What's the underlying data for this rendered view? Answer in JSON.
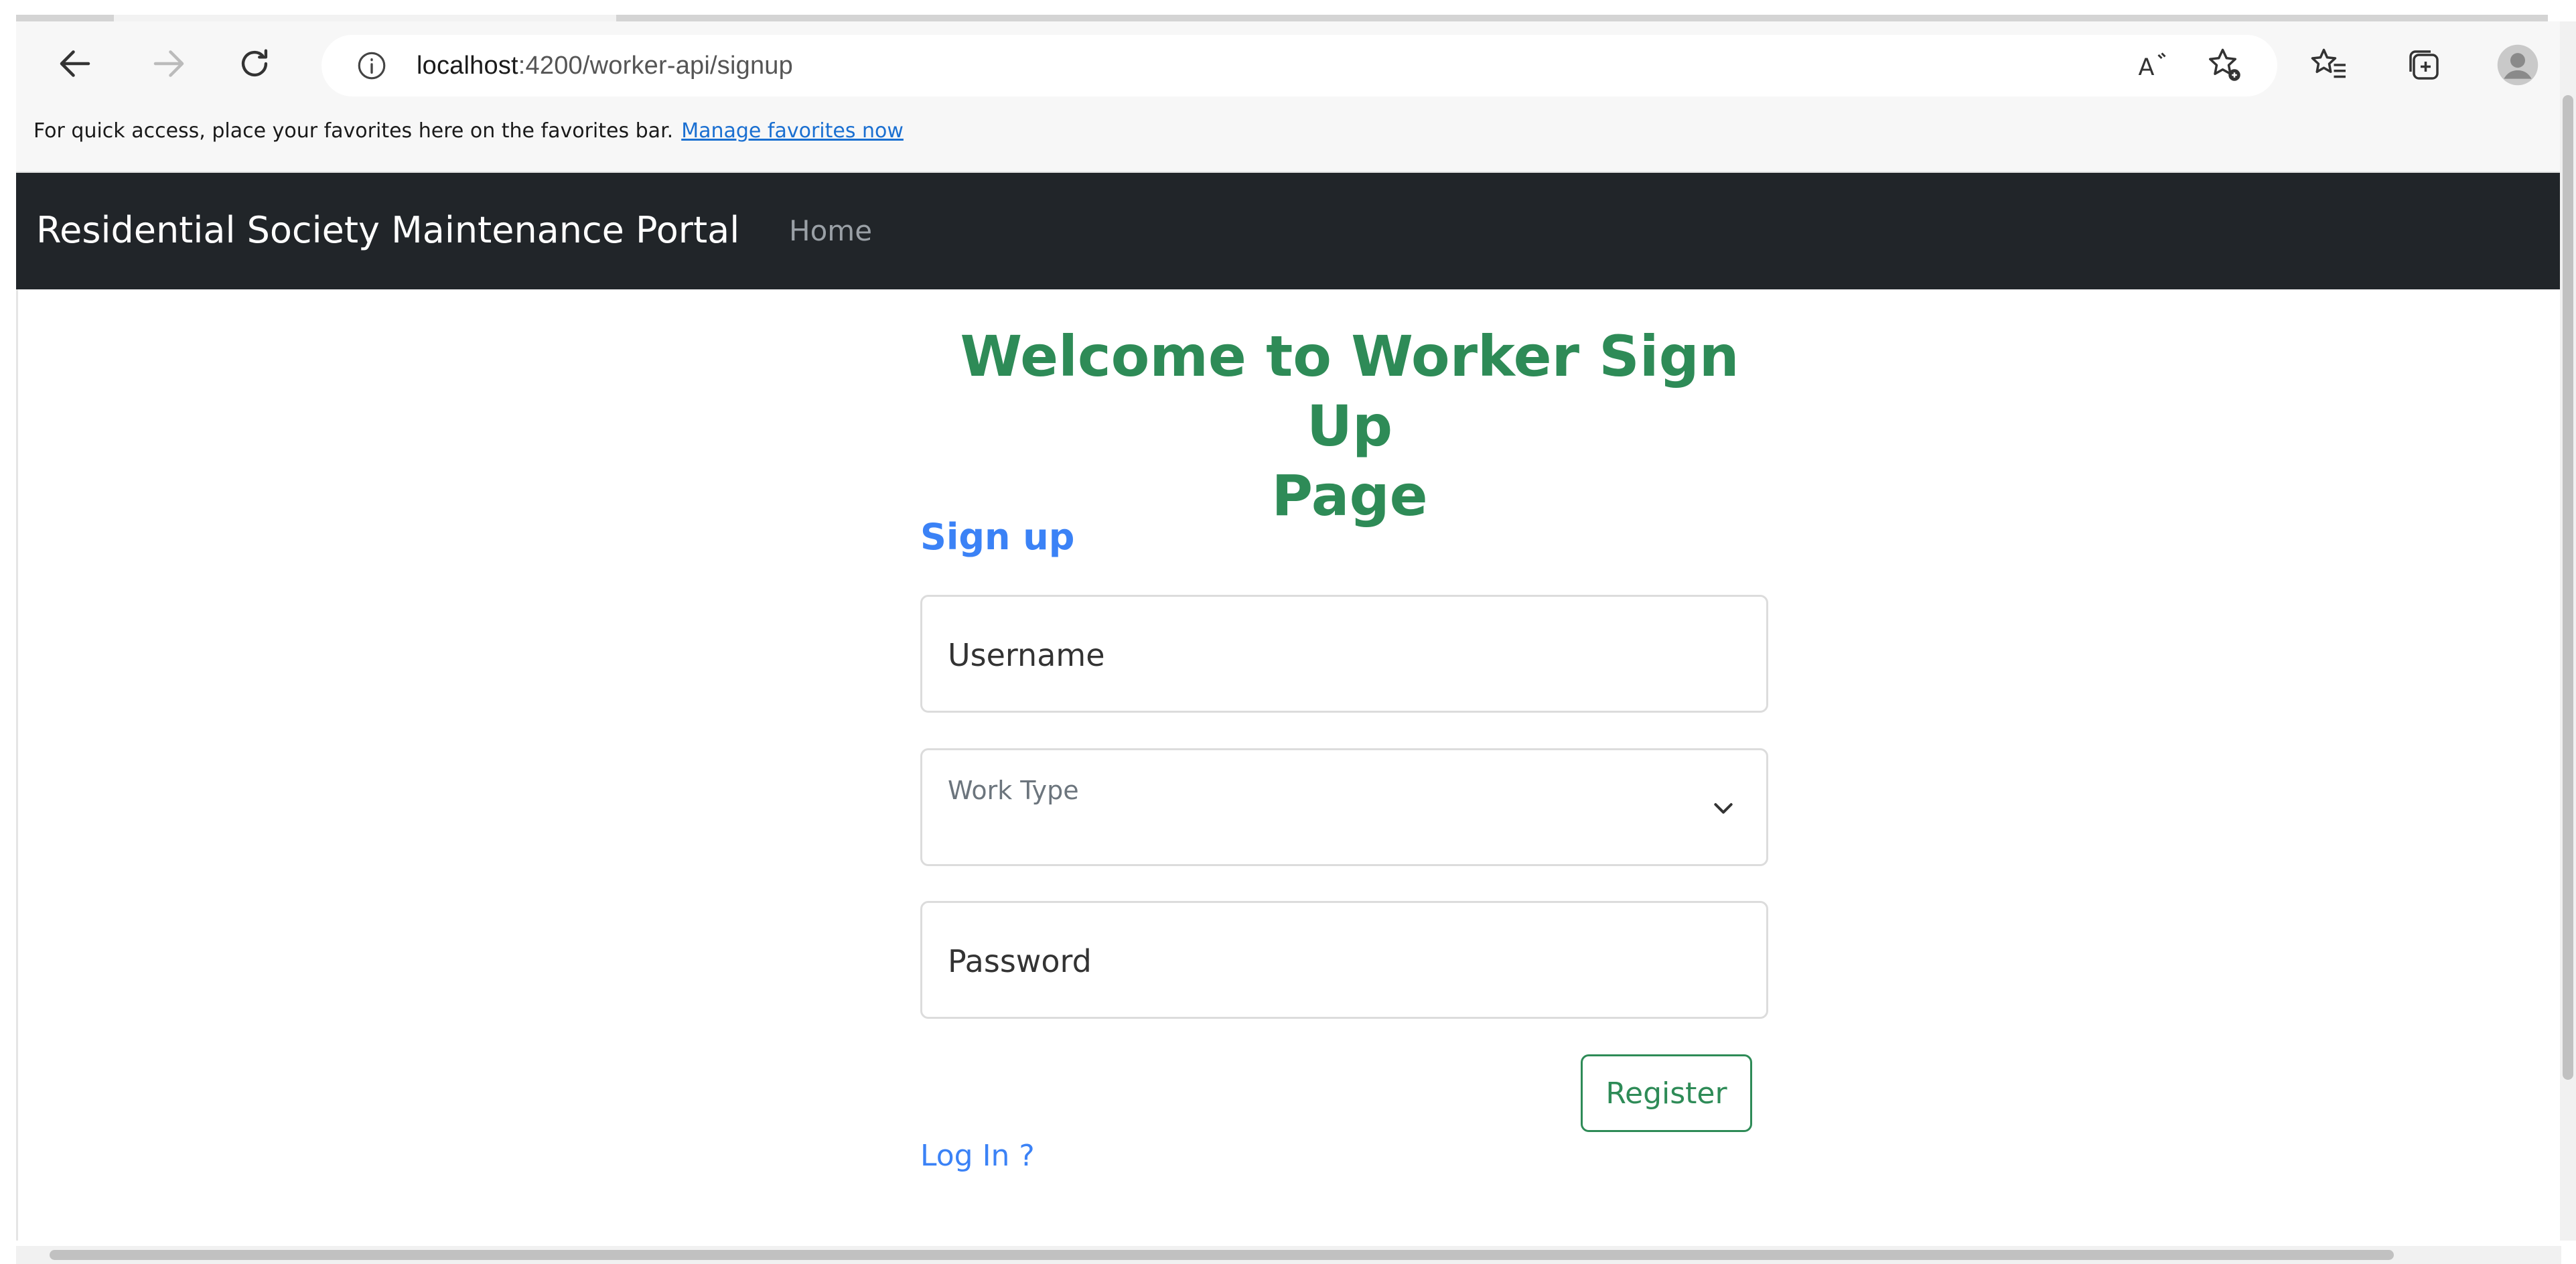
{
  "browser": {
    "url_host": "localhost",
    "url_path": ":4200/worker-api/signup",
    "favorites_prompt": "For quick access, place your favorites here on the favorites bar.",
    "favorites_link": "Manage favorites now",
    "icons": {
      "back": "back-arrow-icon",
      "forward": "forward-arrow-icon",
      "refresh": "refresh-icon",
      "info": "info-icon",
      "read_aloud": "read-aloud-icon",
      "add_favorite": "add-favorite-icon",
      "favorites": "favorites-icon",
      "collections": "collections-icon",
      "profile": "profile-avatar-icon"
    }
  },
  "navbar": {
    "brand": "Residential Society Maintenance Portal",
    "home": "Home",
    "background": "#212529"
  },
  "main": {
    "heading_line1": "Welcome to Worker Sign Up",
    "heading_line2": "Page",
    "heading_color": "#2e8b57",
    "form_title": "Sign up",
    "username_placeholder": "Username",
    "worktype_label": "Work Type",
    "password_placeholder": "Password",
    "register_label": "Register",
    "login_link": "Log In ?",
    "link_color": "#3b82f6"
  }
}
